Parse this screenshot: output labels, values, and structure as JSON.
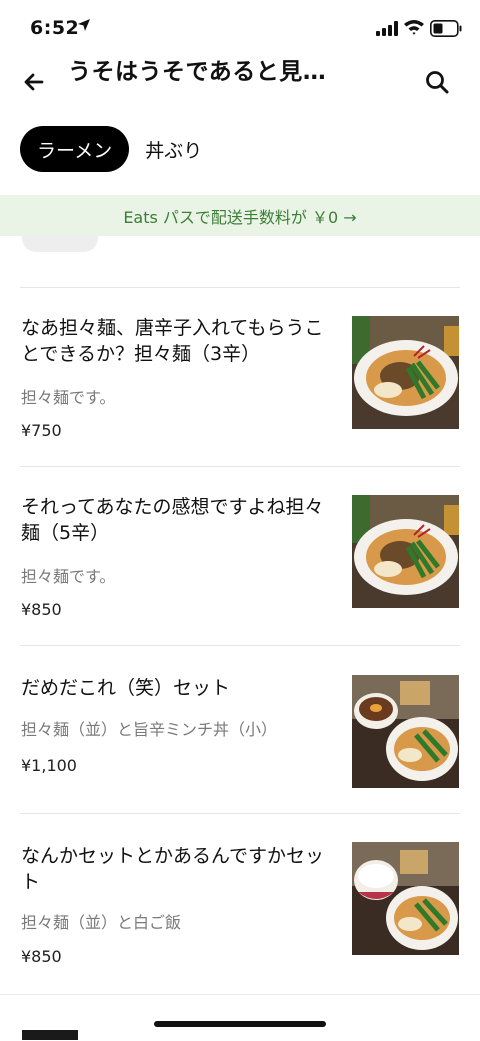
{
  "status_bar": {
    "time": "6:52"
  },
  "header": {
    "title": "うそはうそであると見…"
  },
  "tabs": {
    "active": "ラーメン",
    "other": "丼ぶり"
  },
  "promo": {
    "text": "Eats パスで配送手数料が ￥0 →"
  },
  "items": [
    {
      "name": "なあ担々麺、唐辛子入れてもらうことできるか？担々麺（3辛）",
      "desc": "担々麺です。",
      "price": "¥750"
    },
    {
      "name": "それってあなたの感想ですよね担々麺（5辛）",
      "desc": "担々麺です。",
      "price": "¥850"
    },
    {
      "name": "だめだこれ（笑）セット",
      "desc": "担々麺（並）と旨辛ミンチ丼（小）",
      "price": "¥1,100"
    },
    {
      "name": "なんかセットとかあるんですかセット",
      "desc": "担々麺（並）と白ご飯",
      "price": "¥850"
    }
  ]
}
